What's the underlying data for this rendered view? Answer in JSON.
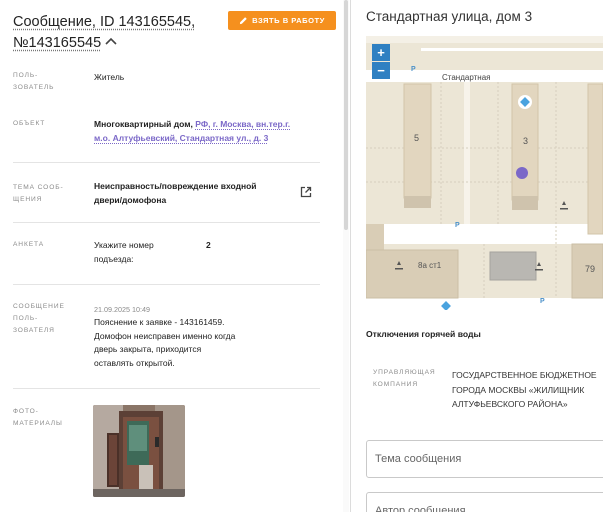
{
  "header": {
    "title_line1": "Сообщение, ID 143165545,",
    "title_line2": "№143165545",
    "take_button_label": "ВЗЯТЬ В РАБОТУ"
  },
  "details": {
    "user": {
      "label_line1": "ПОЛЬ-",
      "label_line2": "ЗОВАТЕЛЬ",
      "value": "Житель"
    },
    "object": {
      "label": "ОБЪЕКТ",
      "value_bold": "Многоквартирный дом,",
      "link_line1": "РФ, г. Москва, вн.тер.г.",
      "link_line2": "м.о. Алтуфьевский, Стандартная ул., д. 3"
    },
    "topic": {
      "label_line1": "ТЕМА СООБ-",
      "label_line2": "ЩЕНИЯ",
      "value_line1": "Неисправность/повреждение входной",
      "value_line2": "двери/домофона"
    },
    "survey": {
      "label": "АНКЕТА",
      "question_line1": "Укажите номер",
      "question_line2": "подъезда:",
      "answer": "2"
    },
    "message": {
      "label_line1": "СООБЩЕНИЕ",
      "label_line2": "ПОЛЬ-",
      "label_line3": "ЗОВАТЕЛЯ",
      "datetime": "21.09.2025 10:49",
      "text_line1": "Пояснение к заявке - 143161459.",
      "text_line2": "Домофон неисправен именно когда",
      "text_line3": "дверь закрыта, приходится",
      "text_line4": "оставлять открытой."
    },
    "photos": {
      "label_line1": "ФОТО-",
      "label_line2": "МАТЕРИАЛЫ"
    }
  },
  "map_panel": {
    "address": "Стандартная улица, дом 3",
    "zoom_in": "+",
    "zoom_out": "−",
    "street_label": "Стандартная",
    "building_5": "5",
    "building_3": "3",
    "building_8a": "8а ст1",
    "building_79": "79",
    "parking": "P"
  },
  "info": {
    "outage_heading": "Отключения горячей воды",
    "uc_label_line1": "УПРАВЛЯЮЩАЯ",
    "uc_label_line2": "КОМПАНИЯ",
    "uc_value_line1": "ГОСУДАРСТВЕННОЕ БЮДЖЕТНОЕ",
    "uc_value_line2": "ГОРОДА МОСКВЫ «ЖИЛИЩНИК",
    "uc_value_line3": "АЛТУФЬЕВСКОГО РАЙОНА»"
  },
  "form": {
    "subject_placeholder": "Тема сообщения",
    "author_placeholder": "Автор сообщения"
  },
  "colors": {
    "accent": "#f5901e",
    "link": "#7b68c8",
    "map_control": "#2f80c2",
    "marker": "#7b68c8"
  }
}
